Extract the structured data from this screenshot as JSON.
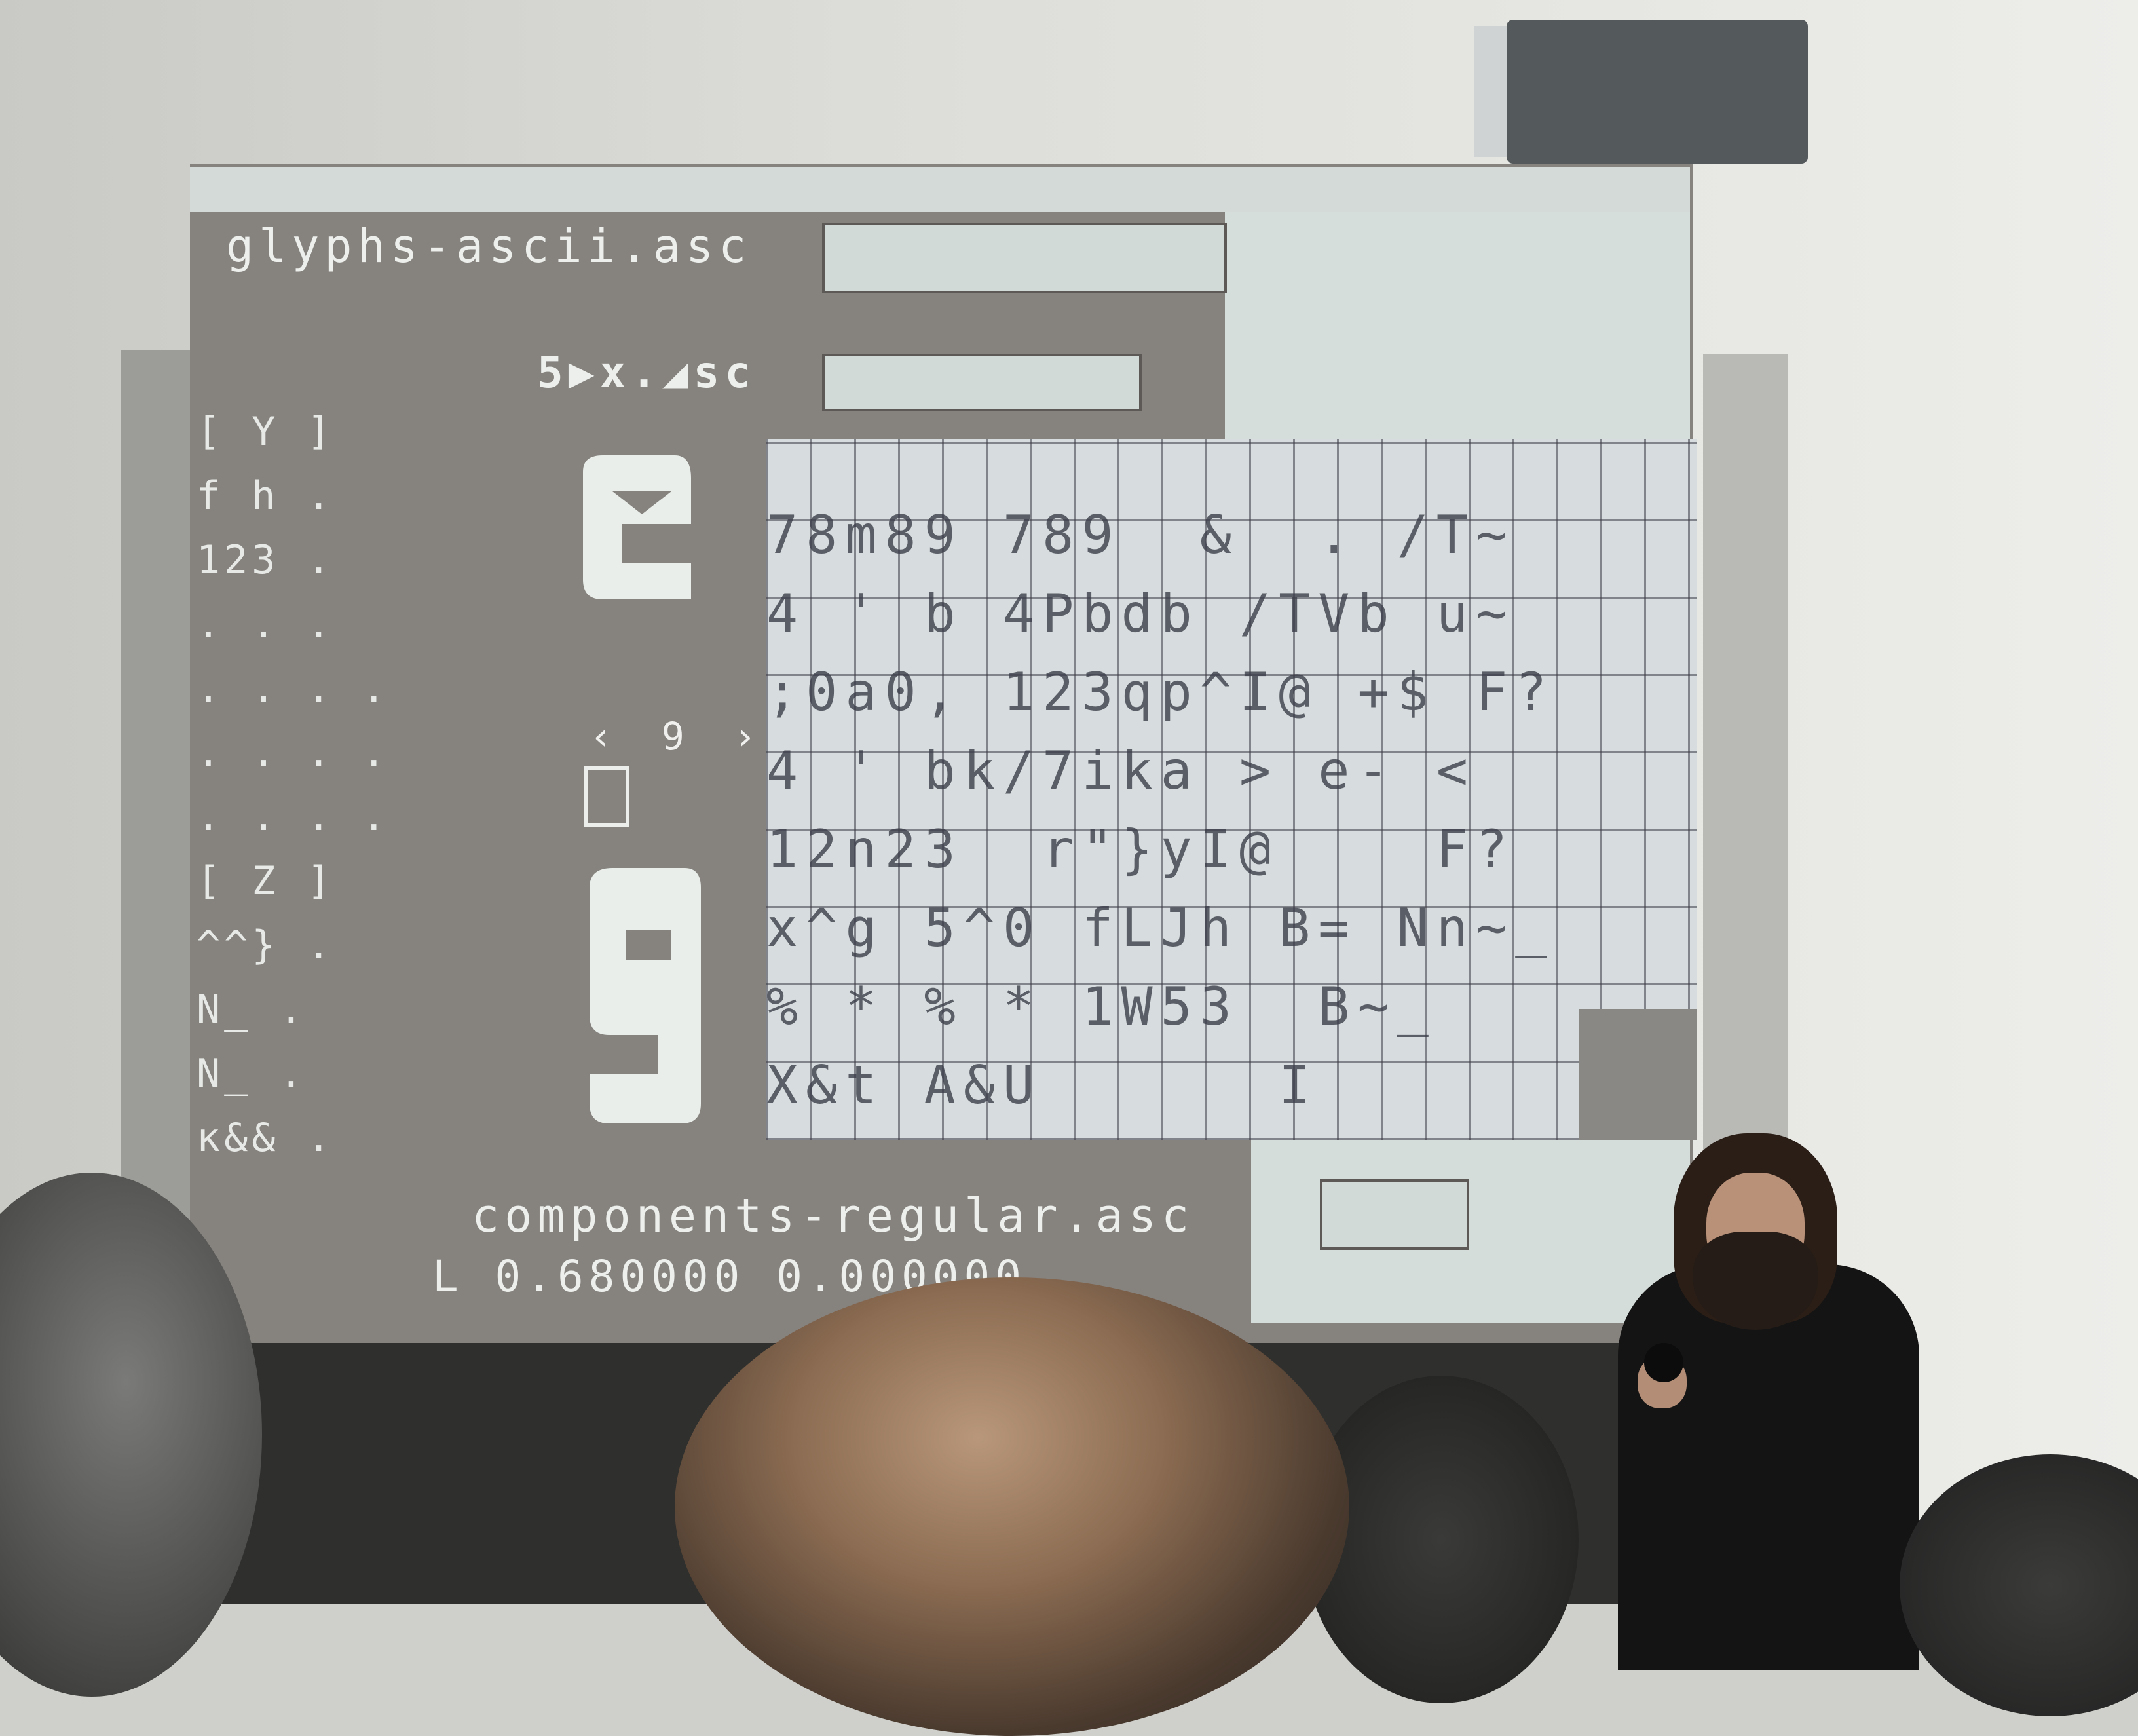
{
  "screen": {
    "file_title": "glyphs-ascii.asc",
    "file_subtitle": "5▶x.◢sc",
    "components_file": "components-regular.asc",
    "coordinate_readout": "L 0.680000 0.000000",
    "left_list": [
      "[ Y ]",
      "f h .",
      "123 .",
      ". . .",
      ". . . .",
      ". . . .",
      ". . . .",
      "",
      "[ Z ]",
      "^^} .",
      " N_ .",
      "N_  .",
      "ĸ&& ."
    ],
    "glyph_nav": "‹ 9 ›",
    "grid_rows": [
      "78m89 789  &  . /T~",
      "4 ' b 4Pbdb /TVb u~",
      ";0a0, 123qp^I@ +$ F?",
      "4 ' bk/7ika > e- <",
      "12n23  r\"}yI@    F?",
      "x^g 5^0 fLJh B= Nn~_",
      "% * % * 1W53  B~_",
      "X&t A&U      I"
    ]
  },
  "icons": {
    "big_glyph_top": "letter-e-glyph",
    "big_glyph_bottom": "digit-9-glyph"
  }
}
